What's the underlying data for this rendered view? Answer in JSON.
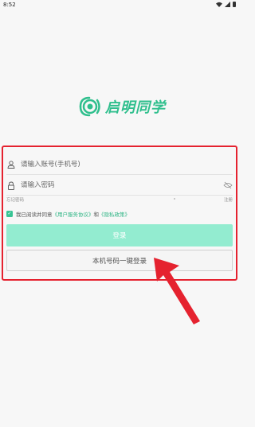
{
  "status_bar": {
    "time": "8:52"
  },
  "app": {
    "brand_name": "启明同学",
    "brand_color": "#2fbf8d"
  },
  "form": {
    "account_placeholder": "请输入账号(手机号)",
    "password_placeholder": "请输入密码",
    "account_icon": "user-icon",
    "password_icon": "lock-icon",
    "password_visibility_icon": "eye-off-icon",
    "forgot_password": "忘记密码",
    "register": "注册"
  },
  "agreement": {
    "checked": true,
    "prefix": "我已阅读并同意",
    "user_agreement": "《用户服务协议》",
    "conjunction": "和",
    "privacy_policy": "《隐私政策》"
  },
  "buttons": {
    "login": "登录",
    "one_click_login": "本机号码一键登录"
  },
  "colors": {
    "accent": "#2fbf8d",
    "login_button": "#93ecd0",
    "annotation_red": "#e5222f"
  }
}
